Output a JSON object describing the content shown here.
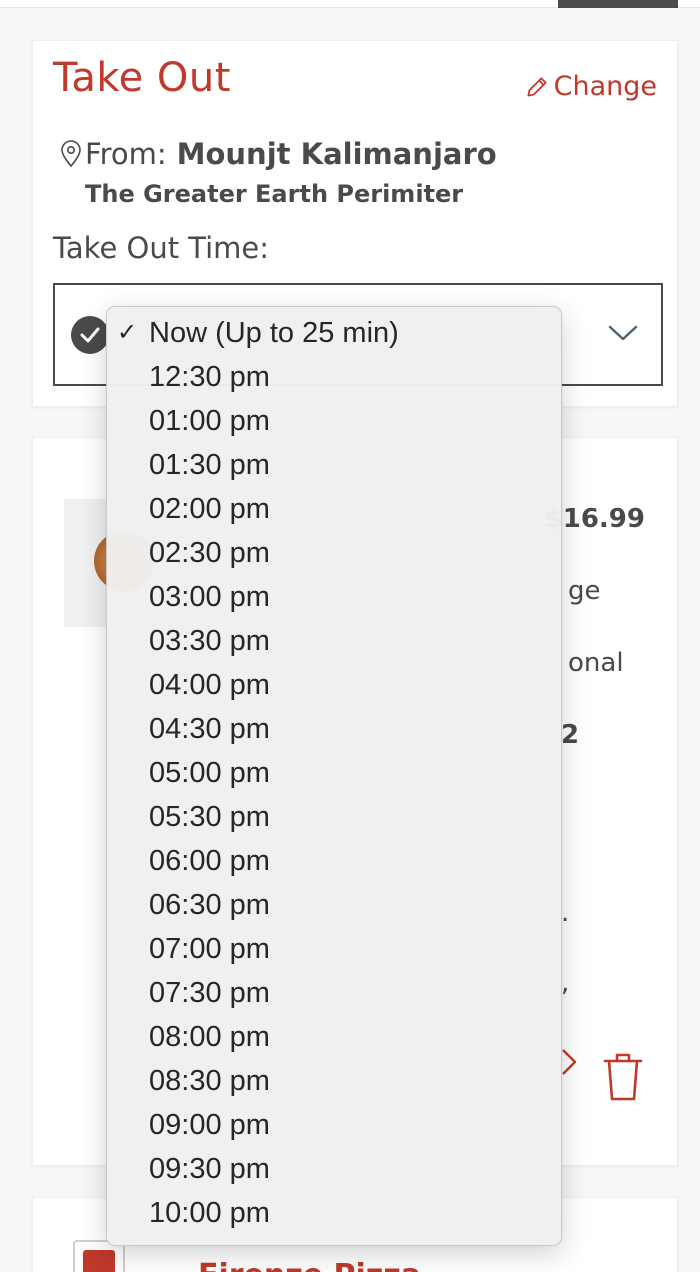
{
  "takeout": {
    "title": "Take Out",
    "change_label": "Change",
    "from_label": "From:",
    "from_name": "Mounjt Kalimanjaro",
    "address": "The Greater Earth Perimiter",
    "time_label": "Take Out Time:"
  },
  "item_card": {
    "price": "$16.99",
    "fragments": [
      "ge",
      "onal",
      "2",
      ".",
      ","
    ]
  },
  "third_card": {
    "title_fragment": "Firenze Pizza"
  },
  "dropdown": {
    "selected_index": 0,
    "checkmark": "✓",
    "options": [
      "Now (Up to 25 min)",
      "12:30 pm",
      "01:00 pm",
      "01:30 pm",
      "02:00 pm",
      "02:30 pm",
      "03:00 pm",
      "03:30 pm",
      "04:00 pm",
      "04:30 pm",
      "05:00 pm",
      "05:30 pm",
      "06:00 pm",
      "06:30 pm",
      "07:00 pm",
      "07:30 pm",
      "08:00 pm",
      "08:30 pm",
      "09:00 pm",
      "09:30 pm",
      "10:00 pm"
    ]
  },
  "colors": {
    "accent": "#c0392b",
    "text": "#4a4a4a",
    "dropdown_bg": "#f0f0f0"
  },
  "icons": {
    "change": "pencil-icon",
    "location": "map-pin-icon",
    "selected": "check-circle-icon",
    "expand": "chevron-down-icon",
    "delete": "trash-icon"
  }
}
